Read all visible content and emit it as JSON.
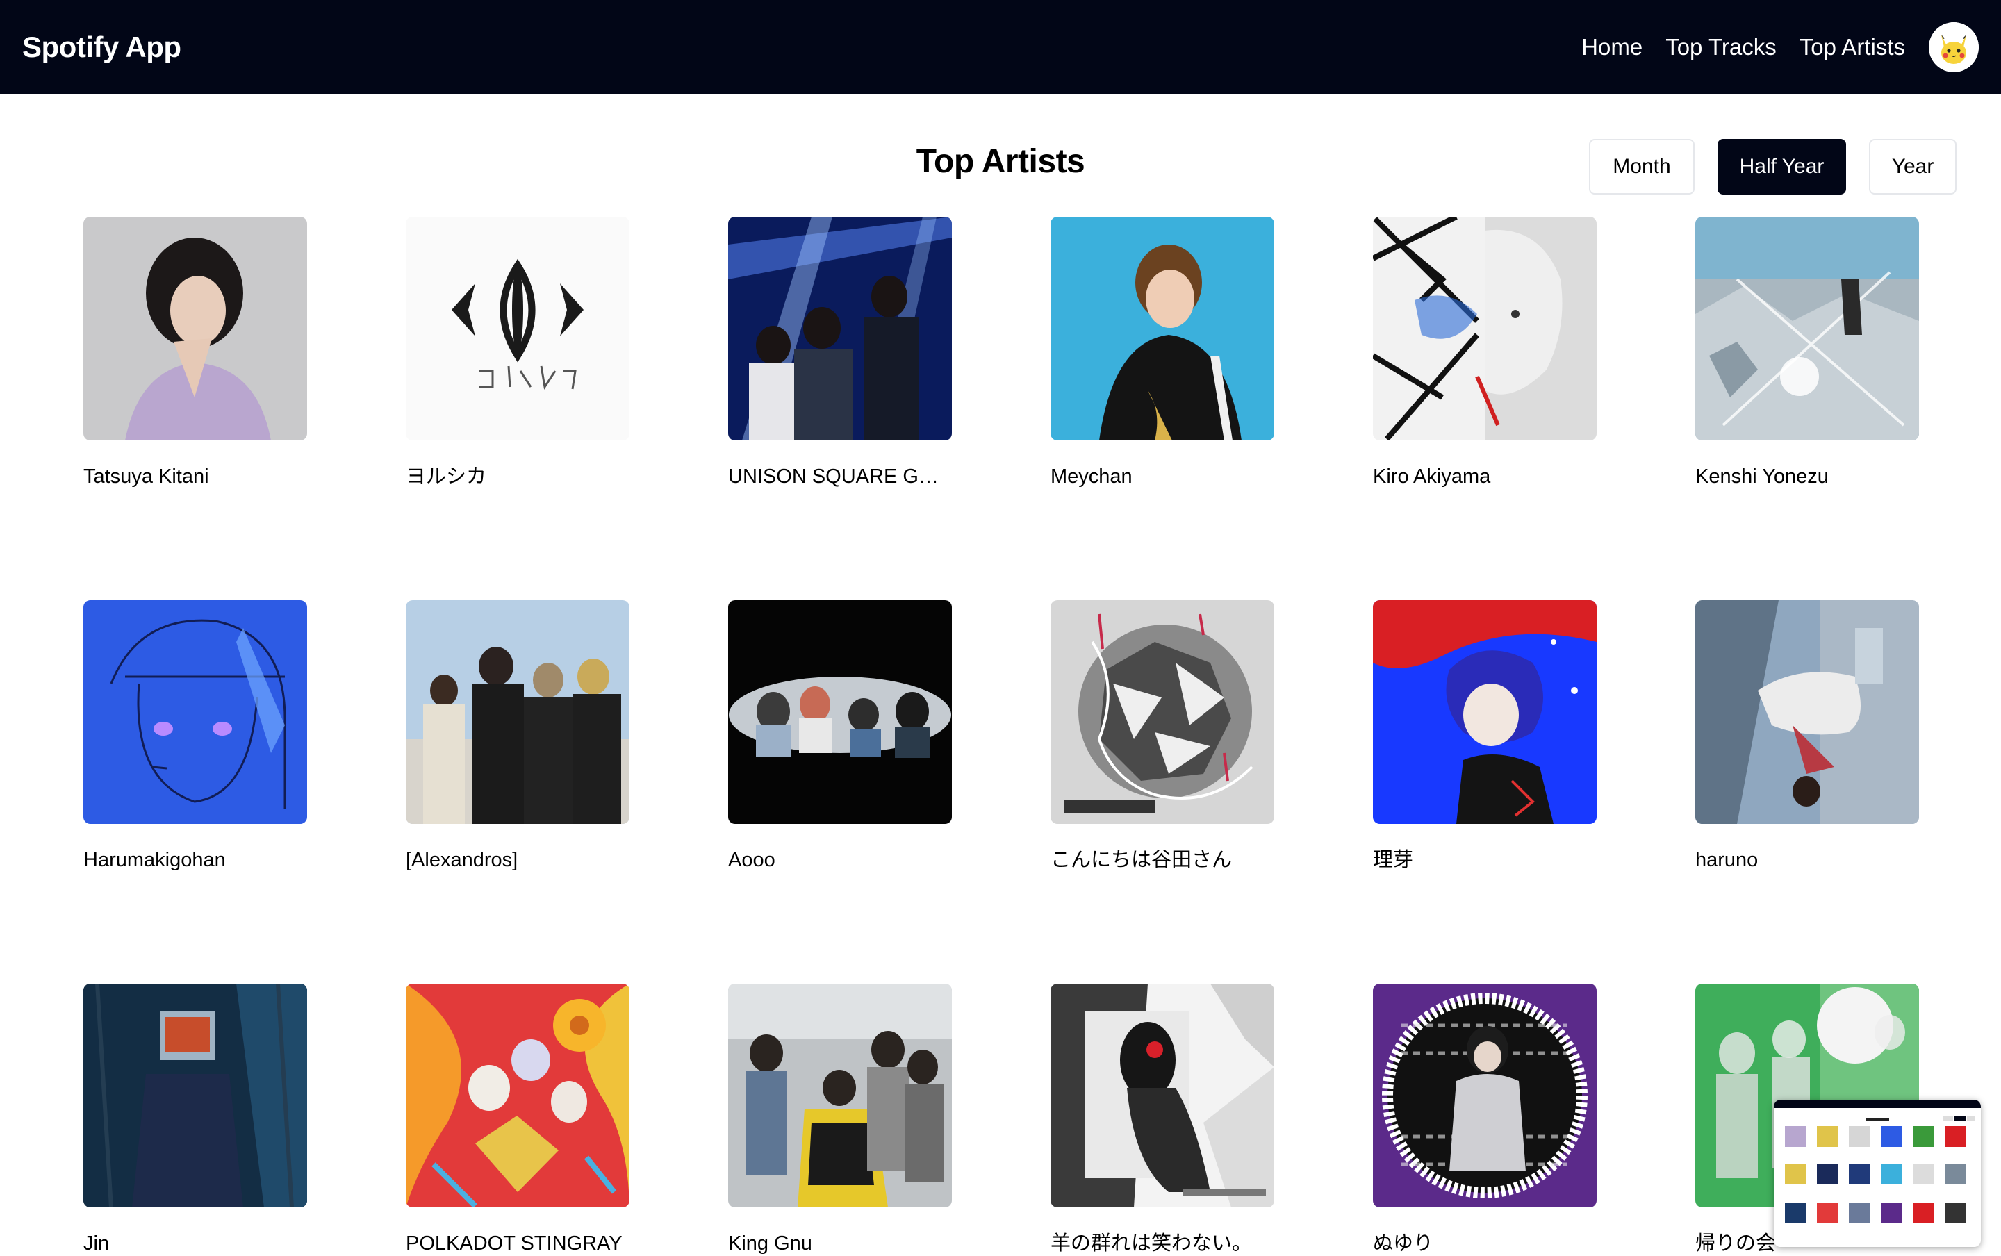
{
  "navbar": {
    "brand": "Spotify App",
    "links": [
      "Home",
      "Top Tracks",
      "Top Artists"
    ],
    "avatar_icon": "pikachu-avatar"
  },
  "page": {
    "title": "Top Artists"
  },
  "time_range": {
    "options": [
      "Month",
      "Half Year",
      "Year"
    ],
    "selected": "Half Year"
  },
  "artists": [
    {
      "name": "Tatsuya Kitani"
    },
    {
      "name": "ヨルシカ"
    },
    {
      "name": "UNISON SQUARE GAR..."
    },
    {
      "name": "Meychan"
    },
    {
      "name": "Kiro Akiyama"
    },
    {
      "name": "Kenshi Yonezu"
    },
    {
      "name": "Harumakigohan"
    },
    {
      "name": "[Alexandros]"
    },
    {
      "name": "Aooo"
    },
    {
      "name": "こんにちは谷田さん"
    },
    {
      "name": "理芽"
    },
    {
      "name": "haruno"
    },
    {
      "name": "Jin"
    },
    {
      "name": "POLKADOT STINGRAY"
    },
    {
      "name": "King Gnu"
    },
    {
      "name": "羊の群れは笑わない。"
    },
    {
      "name": "ぬゆり"
    },
    {
      "name": "帰りの会"
    }
  ],
  "colors": {
    "navbar_bg": "#020617",
    "active_button_bg": "#020617",
    "page_bg": "#ffffff"
  }
}
